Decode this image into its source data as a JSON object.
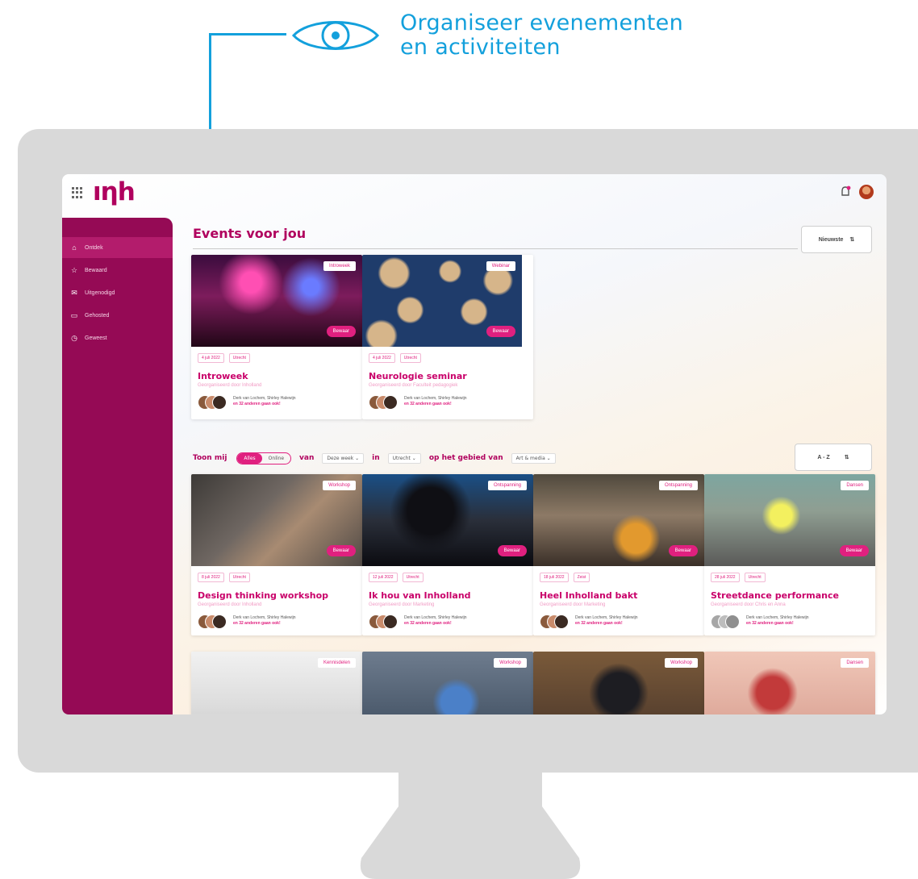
{
  "callout": {
    "line1": "Organiseer evenementen",
    "line2": "en activiteiten",
    "color": "#13a0dc"
  },
  "app": {
    "logo": "ıηh",
    "brand_color": "#950a55",
    "accent_color": "#e0207f"
  },
  "sidebar": {
    "items": [
      {
        "label": "Ontdek",
        "icon": "home-icon",
        "active": true
      },
      {
        "label": "Bewaard",
        "icon": "star-icon"
      },
      {
        "label": "Uitgenodigd",
        "icon": "mail-icon"
      },
      {
        "label": "Gehosted",
        "icon": "calendar-icon"
      },
      {
        "label": "Geweest",
        "icon": "history-icon"
      }
    ]
  },
  "main": {
    "heading": "Events voor jou",
    "sort_label": "Nieuwste",
    "az_label": "A - Z",
    "filter": {
      "toon_mij": "Toon mij",
      "toggle_on": "Alles",
      "toggle_off": "Online",
      "van": "van",
      "period": "Deze week",
      "in": "in",
      "location": "Utrecht",
      "op_het_gebied_van": "op het gebied van",
      "domain": "Art & media"
    }
  },
  "featured": [
    {
      "tag": "Introweek",
      "save": "Bewaar",
      "date": "4 juli 2022",
      "place": "Utrecht",
      "title": "Introweek",
      "org": "Georganiseerd door Inholland",
      "people": "Derk van Lochem, Shirley Halewijn",
      "more": "en 32 anderen gaan ook!"
    },
    {
      "tag": "Webinar",
      "save": "Bewaar",
      "date": "4 juli 2022",
      "place": "Utrecht",
      "title": "Neurologie seminar",
      "org": "Georganiseerd door Faculteit pedagogiek",
      "people": "Derk van Lochem, Shirley Halewijn",
      "more": "en 32 anderen gaan ook!"
    }
  ],
  "events": [
    {
      "tag": "Workshop",
      "save": "Bewaar",
      "date": "8 juli 2022",
      "place": "Utrecht",
      "title": "Design thinking workshop",
      "org": "Georganiseerd door Inholland",
      "people": "Derk van Lochem, Shirley Halewijn",
      "more": "en 32 anderen gaan ook!"
    },
    {
      "tag": "Ontspanning",
      "save": "Bewaar",
      "date": "12 juli 2022",
      "place": "Utrecht",
      "title": "Ik hou van Inholland",
      "org": "Georganiseerd door Marketing",
      "people": "Derk van Lochem, Shirley Halewijn",
      "more": "en 32 anderen gaan ook!"
    },
    {
      "tag": "Ontspanning",
      "save": "Bewaar",
      "date": "18 juli 2022",
      "place": "Zeist",
      "title": "Heel Inholland bakt",
      "org": "Georganiseerd door Marketing",
      "people": "Derk van Lochem, Shirley Halewijn",
      "more": "en 32 anderen gaan ook!"
    },
    {
      "tag": "Dansen",
      "save": "Bewaar",
      "date": "28 juli 2022",
      "place": "Utrecht",
      "title": "Streetdance performance",
      "org": "Georganiseerd door Chris en Anna",
      "people": "Derk van Lochem, Shirley Halewijn",
      "more": "en 32 anderen gaan ook!"
    }
  ],
  "more_events": [
    {
      "tag": "Kennisdelen"
    },
    {
      "tag": "Workshop"
    },
    {
      "tag": "Workshop"
    },
    {
      "tag": "Dansen"
    }
  ]
}
